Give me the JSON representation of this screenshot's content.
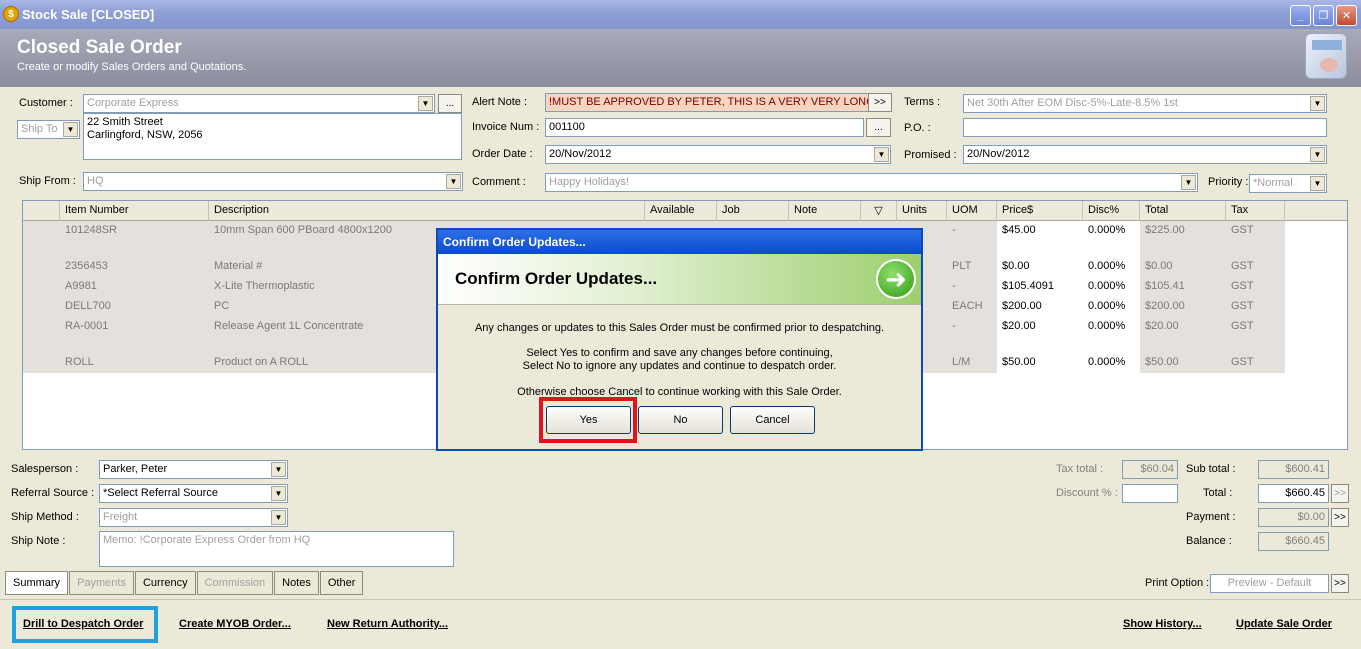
{
  "window": {
    "title": "Stock Sale [CLOSED]"
  },
  "header": {
    "title": "Closed Sale Order",
    "subtitle": "Create or modify Sales Orders and Quotations."
  },
  "form": {
    "customer_label": "Customer :",
    "customer_value": "Corporate Express",
    "ship_to_label": "Ship To",
    "address_line1": "22 Smith Street",
    "address_line2": "Carlingford, NSW, 2056",
    "alert_label": "Alert Note :",
    "alert_value": "!MUST BE APPROVED BY PETER, THIS IS A VERY VERY LONG",
    "invoice_label": "Invoice Num :",
    "invoice_value": "001100",
    "order_date_label": "Order Date :",
    "order_date_value": "20/Nov/2012",
    "terms_label": "Terms :",
    "terms_value": "Net 30th After EOM Disc-5%-Late-8.5% 1st",
    "po_label": "P.O. :",
    "po_value": "",
    "promised_label": "Promised :",
    "promised_value": "20/Nov/2012",
    "ship_from_label": "Ship From :",
    "ship_from_value": "HQ",
    "comment_label": "Comment :",
    "comment_value": "Happy Holidays!",
    "priority_label": "Priority :",
    "priority_value": "*Normal",
    "ellipsis": "...",
    "more": ">>"
  },
  "grid": {
    "columns": [
      "Item Number",
      "Description",
      "Available",
      "Job",
      "Note",
      "▽",
      "Units",
      "UOM",
      "Price$",
      "Disc%",
      "Total",
      "Tax"
    ],
    "rows": [
      {
        "item": "101248SR",
        "desc": "10mm Span 600 PBoard 4800x1200",
        "uom": "-",
        "price": "$45.00",
        "disc": "0.000%",
        "total": "$225.00",
        "tax": "GST"
      },
      {
        "item": "2356453",
        "desc": "Material #",
        "uom": "PLT",
        "price": "$0.00",
        "disc": "0.000%",
        "total": "$0.00",
        "tax": "GST"
      },
      {
        "item": "A9981",
        "desc": "X-Lite Thermoplastic",
        "uom": "-",
        "price": "$105.4091",
        "disc": "0.000%",
        "total": "$105.41",
        "tax": "GST"
      },
      {
        "item": "DELL700",
        "desc": "PC",
        "uom": "EACH",
        "price": "$200.00",
        "disc": "0.000%",
        "total": "$200.00",
        "tax": "GST"
      },
      {
        "item": "RA-0001",
        "desc": "Release Agent 1L Concentrate",
        "uom": "-",
        "price": "$20.00",
        "disc": "0.000%",
        "total": "$20.00",
        "tax": "GST"
      },
      {
        "item": "ROLL",
        "desc": "Product on A ROLL",
        "uom": "L/M",
        "price": "$50.00",
        "disc": "0.000%",
        "total": "$50.00",
        "tax": "GST"
      }
    ]
  },
  "bottom": {
    "salesperson_label": "Salesperson :",
    "salesperson_value": "Parker, Peter",
    "referral_label": "Referral Source :",
    "referral_value": "*Select Referral Source",
    "ship_method_label": "Ship Method :",
    "ship_method_value": "Freight",
    "ship_note_label": "Ship Note :",
    "ship_note_value": "Memo: !Corporate Express Order from HQ",
    "tax_total_label": "Tax total :",
    "tax_total_value": "$60.04",
    "discount_label": "Discount % :",
    "discount_value": "",
    "subtotal_label": "Sub total :",
    "subtotal_value": "$600.41",
    "total_label": "Total :",
    "total_value": "$660.45",
    "payment_label": "Payment :",
    "payment_value": "$0.00",
    "balance_label": "Balance :",
    "balance_value": "$660.45"
  },
  "tabs": [
    "Summary",
    "Payments",
    "Currency",
    "Commission",
    "Notes",
    "Other"
  ],
  "print_option": {
    "label": "Print Option :",
    "value": "Preview - Default"
  },
  "footer": {
    "drill": "Drill to Despatch Order",
    "myob": "Create MYOB Order...",
    "return": "New Return Authority...",
    "history": "Show History...",
    "update": "Update Sale Order"
  },
  "dialog": {
    "title": "Confirm Order Updates...",
    "heading": "Confirm Order Updates...",
    "line1": "Any changes or updates to this Sales Order must be confirmed prior to despatching.",
    "line2": "Select Yes to confirm and save any changes before continuing,",
    "line3": "Select No to ignore any updates and continue to despatch order.",
    "line4": "Otherwise choose Cancel to continue working with this Sale Order.",
    "yes": "Yes",
    "no": "No",
    "cancel": "Cancel"
  }
}
